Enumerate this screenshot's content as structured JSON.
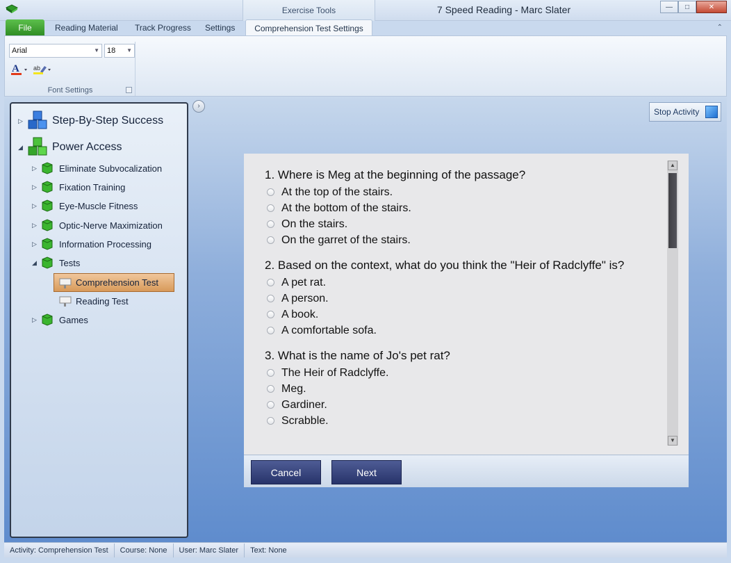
{
  "window": {
    "context_tab_header": "Exercise Tools",
    "title": "7 Speed Reading - Marc Slater"
  },
  "ribbon": {
    "tabs": {
      "file": "File",
      "reading_material": "Reading Material",
      "track_progress": "Track Progress",
      "settings": "Settings",
      "comprehension_settings": "Comprehension Test Settings"
    },
    "font_group": {
      "font_name": "Arial",
      "font_size": "18",
      "label": "Font Settings"
    }
  },
  "sidebar": {
    "sections": [
      {
        "label": "Step-By-Step Success"
      },
      {
        "label": "Power Access"
      }
    ],
    "items": [
      {
        "label": "Eliminate Subvocalization"
      },
      {
        "label": "Fixation Training"
      },
      {
        "label": "Eye-Muscle Fitness"
      },
      {
        "label": "Optic-Nerve Maximization"
      },
      {
        "label": "Information Processing"
      },
      {
        "label": "Tests"
      },
      {
        "label": "Comprehension Test"
      },
      {
        "label": "Reading Test"
      },
      {
        "label": "Games"
      }
    ]
  },
  "stop_activity": "Stop Activity",
  "quiz": {
    "questions": [
      {
        "text": "1. Where is Meg at the beginning of the passage?",
        "options": [
          "At the top of the stairs.",
          "At the bottom of the stairs.",
          "On the stairs.",
          "On the garret of the stairs."
        ]
      },
      {
        "text": "2. Based on the context, what do you think the \"Heir of Radclyffe\" is?",
        "options": [
          "A pet rat.",
          "A person.",
          "A book.",
          "A comfortable sofa."
        ]
      },
      {
        "text": "3. What is the name of Jo's pet rat?",
        "options": [
          "The Heir of Radclyffe.",
          "Meg.",
          "Gardiner.",
          "Scrabble."
        ]
      }
    ],
    "cancel": "Cancel",
    "next": "Next"
  },
  "status": {
    "activity": "Activity: Comprehension Test",
    "course": "Course: None",
    "user": "User: Marc Slater",
    "text": "Text: None"
  }
}
